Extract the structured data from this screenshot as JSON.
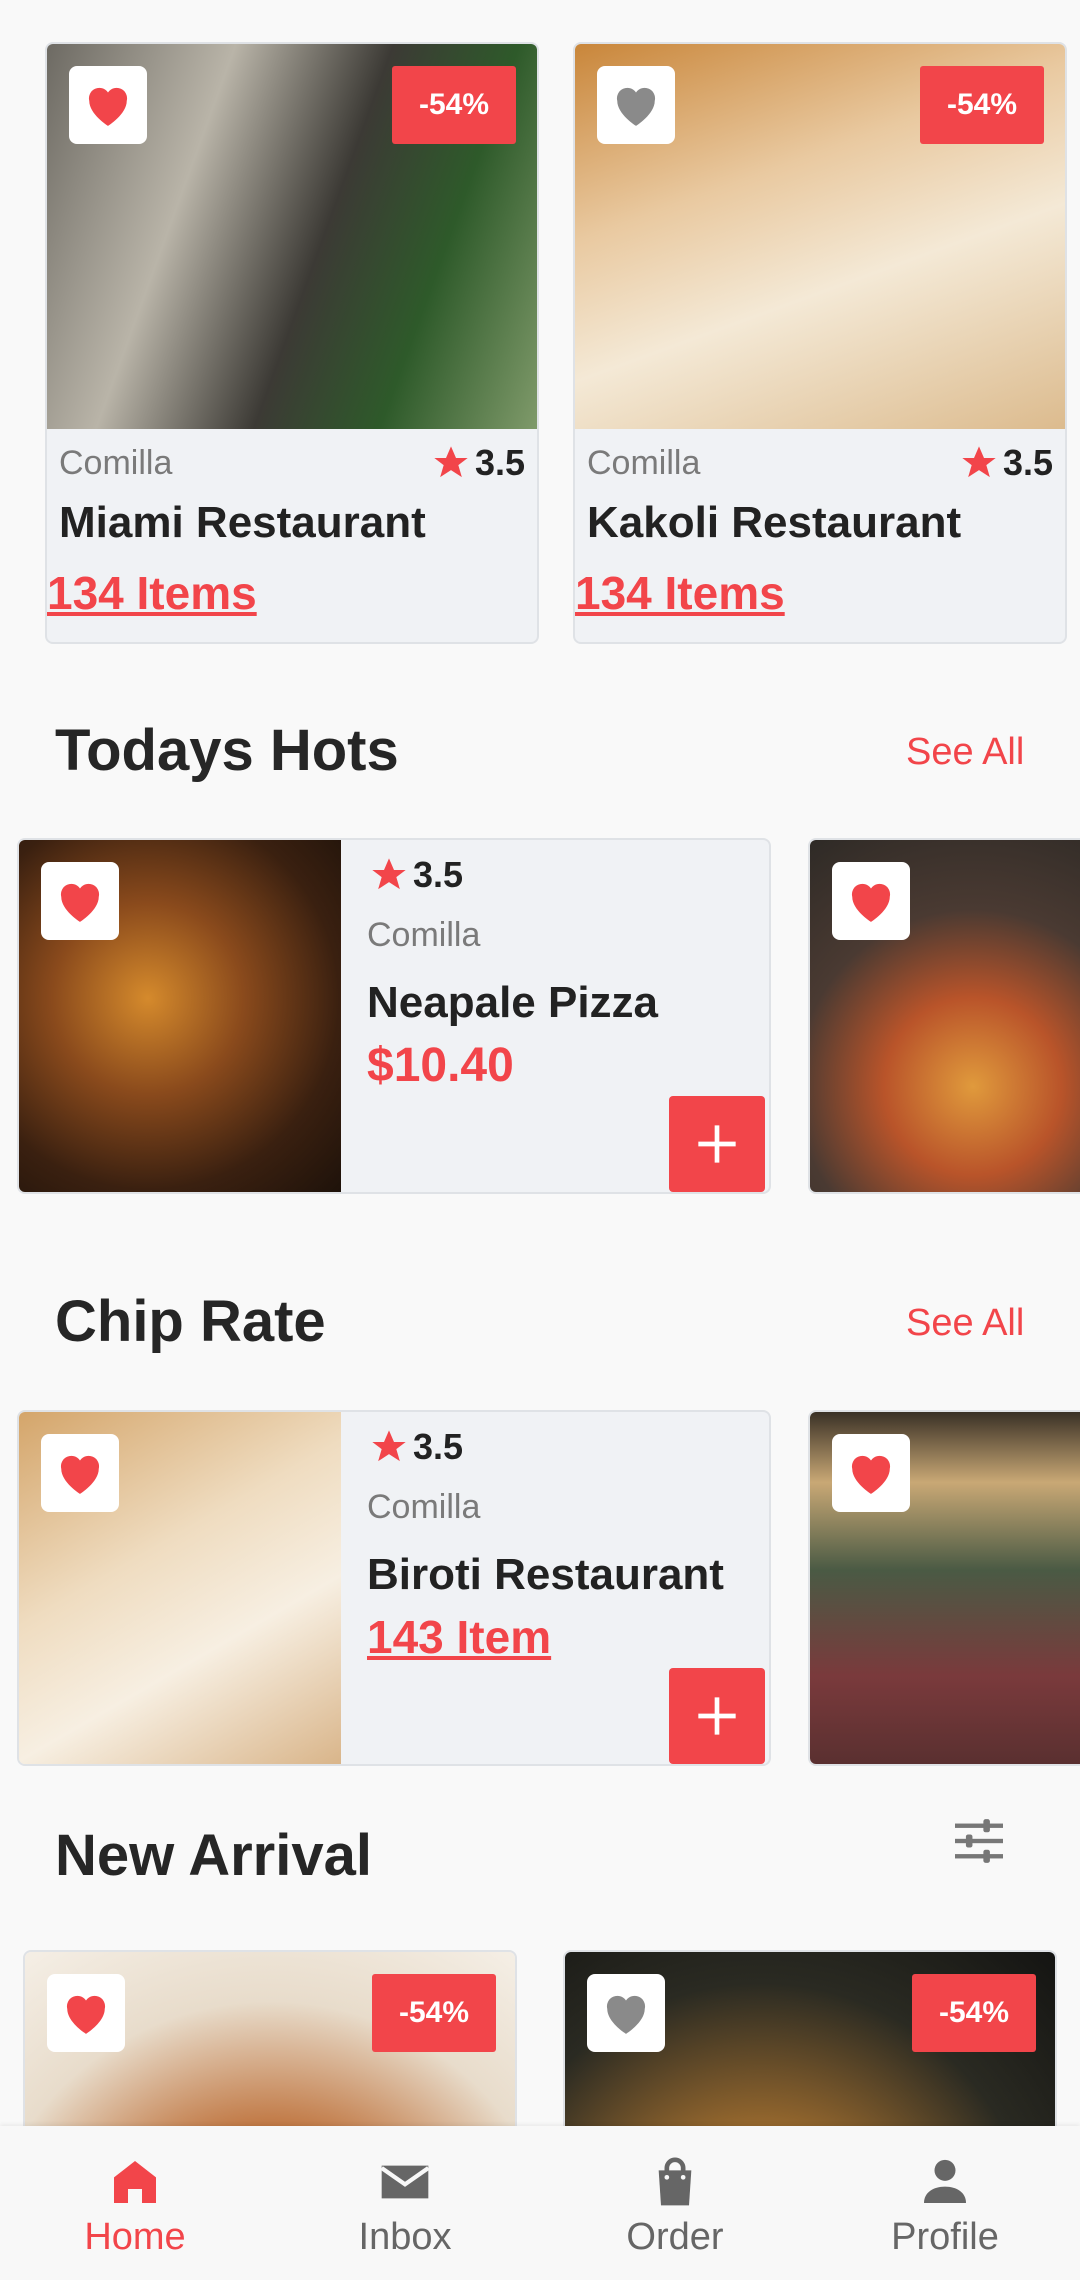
{
  "restaurants": [
    {
      "location": "Comilla",
      "rating": "3.5",
      "name": "Miami Restaurant",
      "items": "134 Items",
      "discount": "-54%",
      "favorite": true
    },
    {
      "location": "Comilla",
      "rating": "3.5",
      "name": "Kakoli Restaurant",
      "items": "134 Items",
      "discount": "-54%",
      "favorite": false
    }
  ],
  "todays_hots": {
    "title": "Todays Hots",
    "see_all": "See All",
    "card": {
      "rating": "3.5",
      "location": "Comilla",
      "name": "Neapale Pizza",
      "price": "$10.40"
    }
  },
  "chip_rate": {
    "title": "Chip Rate",
    "see_all": "See All",
    "card": {
      "rating": "3.5",
      "location": "Comilla",
      "name": "Biroti Restaurant",
      "items": "143 Item"
    }
  },
  "new_arrival": {
    "title": "New Arrival",
    "cards": [
      {
        "discount": "-54%",
        "favorite": true
      },
      {
        "discount": "-54%",
        "favorite": false
      }
    ]
  },
  "bottom_nav": [
    {
      "label": "Home",
      "icon": "home-icon",
      "active": true
    },
    {
      "label": "Inbox",
      "icon": "mail-icon",
      "active": false
    },
    {
      "label": "Order",
      "icon": "shopping-bag-icon",
      "active": false
    },
    {
      "label": "Profile",
      "icon": "person-icon",
      "active": false
    }
  ],
  "colors": {
    "accent": "#f2454a",
    "inactive": "#666666",
    "card_bg": "#f0f2f5"
  }
}
